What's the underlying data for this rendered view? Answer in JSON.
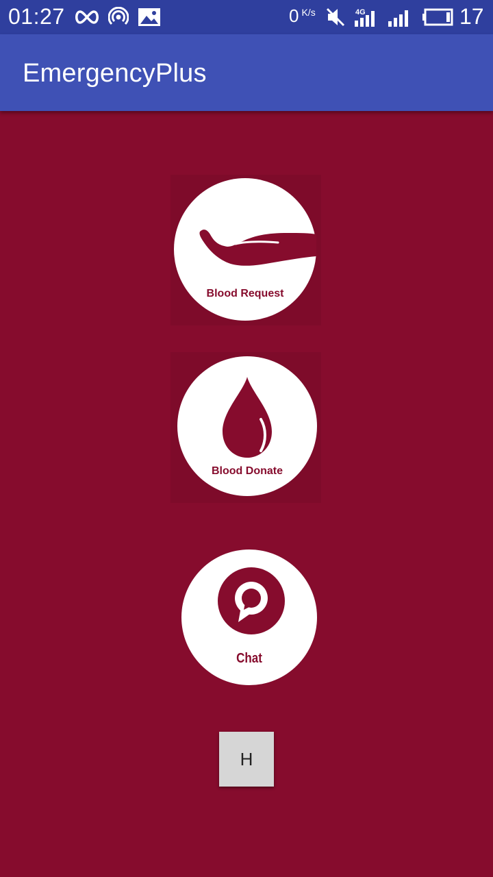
{
  "status_bar": {
    "time": "01:27",
    "speed_value": "0",
    "speed_unit": "K/s",
    "network_label": "4G",
    "battery_level": "17",
    "icons": [
      "infinity-icon",
      "hotspot-icon",
      "image-icon",
      "mute-icon",
      "network-4g-icon",
      "signal-icon",
      "battery-icon"
    ]
  },
  "app_bar": {
    "title": "EmergencyPlus"
  },
  "main": {
    "buttons": [
      {
        "label": "Blood Request",
        "icon": "hand-icon"
      },
      {
        "label": "Blood Donate",
        "icon": "blood-drop-icon"
      },
      {
        "label": "Chat",
        "icon": "chat-bubble-icon"
      }
    ],
    "h_button_label": "H"
  },
  "colors": {
    "status_bar": "#2f3f9e",
    "app_bar": "#3f51b5",
    "background": "#860c2d",
    "accent": "#860c2d",
    "button_gray": "#d6d6d6"
  }
}
